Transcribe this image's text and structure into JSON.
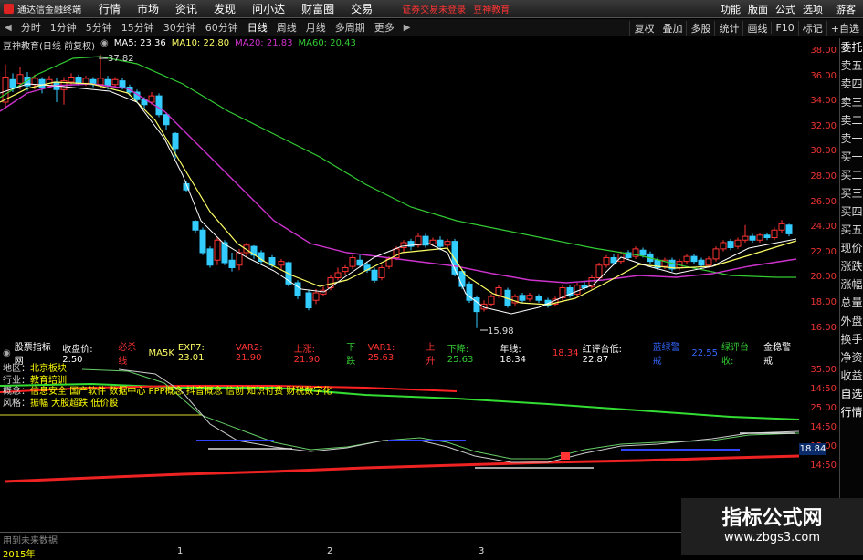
{
  "app": {
    "logo_text": "通达信金融终端",
    "menu": [
      "行情",
      "市场",
      "资讯",
      "发现",
      "问小达",
      "财富圈",
      "交易"
    ],
    "warning": "证券交易未登录",
    "brand": "豆神教育",
    "right_menu": [
      "功能",
      "版面",
      "公式",
      "选项"
    ],
    "guest": "游客"
  },
  "period_bar": {
    "periods": [
      "分时",
      "1分钟",
      "5分钟",
      "15分钟",
      "30分钟",
      "60分钟",
      "日线",
      "周线",
      "月线",
      "多周期",
      "更多"
    ],
    "active": "日线",
    "right_tools": [
      "复权",
      "叠加",
      "多股",
      "统计",
      "画线",
      "F10",
      "标记",
      "+自选"
    ]
  },
  "main_chart": {
    "title": "豆神教育(日线 前复权)",
    "ma5": "MA5: 23.36",
    "ma10": "MA10: 22.80",
    "ma20": "MA20: 21.83",
    "ma60": "MA60: 20.43",
    "high_label": "37.82",
    "low_label": "15.98",
    "y_ticks": [
      "38.00",
      "36.00",
      "34.00",
      "32.00",
      "30.00",
      "28.00",
      "26.00",
      "24.00",
      "22.00",
      "20.00",
      "18.00",
      "16.00"
    ],
    "colors": {
      "up": "#ff3333",
      "down": "#33ccff",
      "ma5": "#ffffff",
      "ma10": "#ffff66",
      "ma20": "#cc33cc",
      "ma60": "#33cc33"
    }
  },
  "sidebar": [
    "委托",
    "卖五",
    "卖四",
    "卖三",
    "卖二",
    "卖一",
    "买一",
    "买二",
    "买三",
    "买四",
    "买五",
    "现价",
    "涨跌",
    "涨幅",
    "总量",
    "外盘",
    "换手",
    "净资",
    "收益",
    "自选",
    "行情"
  ],
  "indicator": {
    "name": "股票指标网",
    "items": [
      {
        "t": "收盘价: 2.50",
        "c": "#ffffff"
      },
      {
        "t": "必杀线",
        "c": "#ff3333"
      },
      {
        "t": "MA5K",
        "c": "#ffff66"
      },
      {
        "t": "EXP7: 23.01",
        "c": "#ffff66"
      },
      {
        "t": "VAR2: 21.90",
        "c": "#ff3333"
      },
      {
        "t": "上涨: 21.90",
        "c": "#ff3333"
      },
      {
        "t": "下跌",
        "c": "#33cc33"
      },
      {
        "t": "VAR1: 25.63",
        "c": "#ff3333"
      },
      {
        "t": "上升",
        "c": "#ff3333"
      },
      {
        "t": "下降: 25.63",
        "c": "#33cc33"
      },
      {
        "t": "年线: 18.34",
        "c": "#ffffff"
      },
      {
        "t": "18.34",
        "c": "#ff3333"
      },
      {
        "t": "红评台低: 22.87",
        "c": "#ffffff"
      },
      {
        "t": "蓝绿警戒",
        "c": "#3366ff"
      },
      {
        "t": "22.55",
        "c": "#3366ff"
      },
      {
        "t": "绿评台收:",
        "c": "#33cc33"
      },
      {
        "t": "金稳警戒",
        "c": "#ffffff"
      }
    ],
    "y_ticks": [
      "35.00",
      "14:50",
      "25.00",
      "14:50",
      "15.00",
      "14:50"
    ],
    "badge": "18.84"
  },
  "info": {
    "region_label": "地区：",
    "region": "北京板块",
    "industry_label": "行业：",
    "industry": "教育培训",
    "concept_label": "概念：",
    "concept": "信息安全 国产软件 数据中心 PPP概念 抖音概念 信创 知识付费 财税数字化",
    "style_label": "风格：",
    "style": "振幅 大股超跌 低价股"
  },
  "bottom": {
    "useinfo": "用到未来数据",
    "x_labels": [
      "2015年",
      "1",
      "2",
      "3"
    ]
  },
  "watermark": {
    "title": "指标公式网",
    "url": "www.zbgs3.com"
  }
}
